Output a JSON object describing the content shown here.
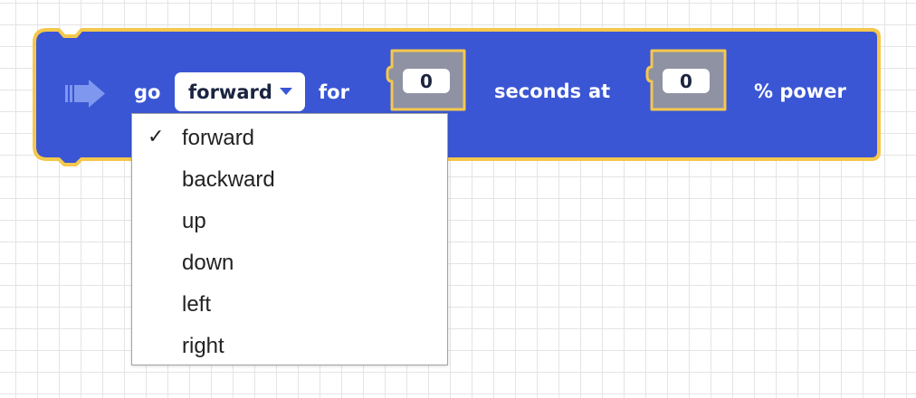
{
  "block": {
    "color": "#3a56d4",
    "outline_color": "#f5c84c",
    "icon": "arrow-right-icon",
    "label_go": "go",
    "direction_value": "forward",
    "label_for": "for",
    "duration_value": "0",
    "label_seconds": "seconds",
    "label_at": "at",
    "power_value": "0",
    "label_power": "% power"
  },
  "dropdown_menu": {
    "selected_icon": "checkmark-icon",
    "selected_mark": "✓",
    "items": [
      {
        "label": "forward",
        "selected": true
      },
      {
        "label": "backward",
        "selected": false
      },
      {
        "label": "up",
        "selected": false
      },
      {
        "label": "down",
        "selected": false
      },
      {
        "label": "left",
        "selected": false
      },
      {
        "label": "right",
        "selected": false
      }
    ]
  }
}
